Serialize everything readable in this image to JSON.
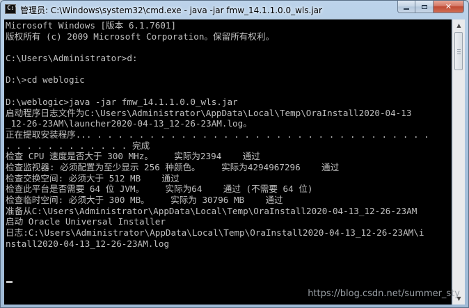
{
  "window": {
    "title": "管理员: C:\\Windows\\system32\\cmd.exe - java  -jar fmw_14.1.1.0.0_wls.jar",
    "icon": "cmd-icon",
    "controls": {
      "minimize": "minimize-icon",
      "maximize": "maximize-icon",
      "close": "close-icon",
      "close_glyph": "✕"
    }
  },
  "console": {
    "background": "#000000",
    "foreground": "#c0c0c0",
    "lines": [
      "Microsoft Windows [版本 6.1.7601]",
      "版权所有 (c) 2009 Microsoft Corporation。保留所有权利。",
      "",
      "C:\\Users\\Administrator>d:",
      "",
      "D:\\>cd weblogic",
      "",
      "D:\\weblogic>java -jar fmw_14.1.1.0.0_wls.jar",
      "启动程序日志文件为C:\\Users\\Administrator\\AppData\\Local\\Temp\\OraInstall2020-04-13",
      "_12-26-23AM\\launcher2020-04-13_12-26-23AM.log。",
      "正在提取安装程序... . . . . . . . . . . . . . . . . . . . . . . . . . . . . . . . .",
      ". . . . . . . . . . . . 完成",
      "检查 CPU 速度是否大于 300 MHz。    实际为2394    通过",
      "检查监视器: 必须配置为至少显示 256 种颜色。    实际为4294967296    通过",
      "检查交换空间: 必须大于 512 MB    通过",
      "检查此平台是否需要 64 位 JVM。    实际为64    通过 (不需要 64 位)",
      "检查临时空间: 必须大于 300 MB。    实际为 30796 MB    通过",
      "准备从C:\\Users\\Administrator\\AppData\\Local\\Temp\\OraInstall2020-04-13_12-26-23AM",
      "启动 Oracle Universal Installer",
      "日志:C:\\Users\\Administrator\\AppData\\Local\\Temp\\OraInstall2020-04-13_12-26-23AM\\i",
      "nstall2020-04-13_12-26-23AM.log",
      ""
    ]
  },
  "scrollbar": {
    "up_arrow": "▲",
    "down_arrow": "▼",
    "up_icon": "scroll-up-arrow-icon",
    "down_icon": "scroll-down-arrow-icon"
  },
  "watermark": "https://blog.csdn.net/summer_sty"
}
